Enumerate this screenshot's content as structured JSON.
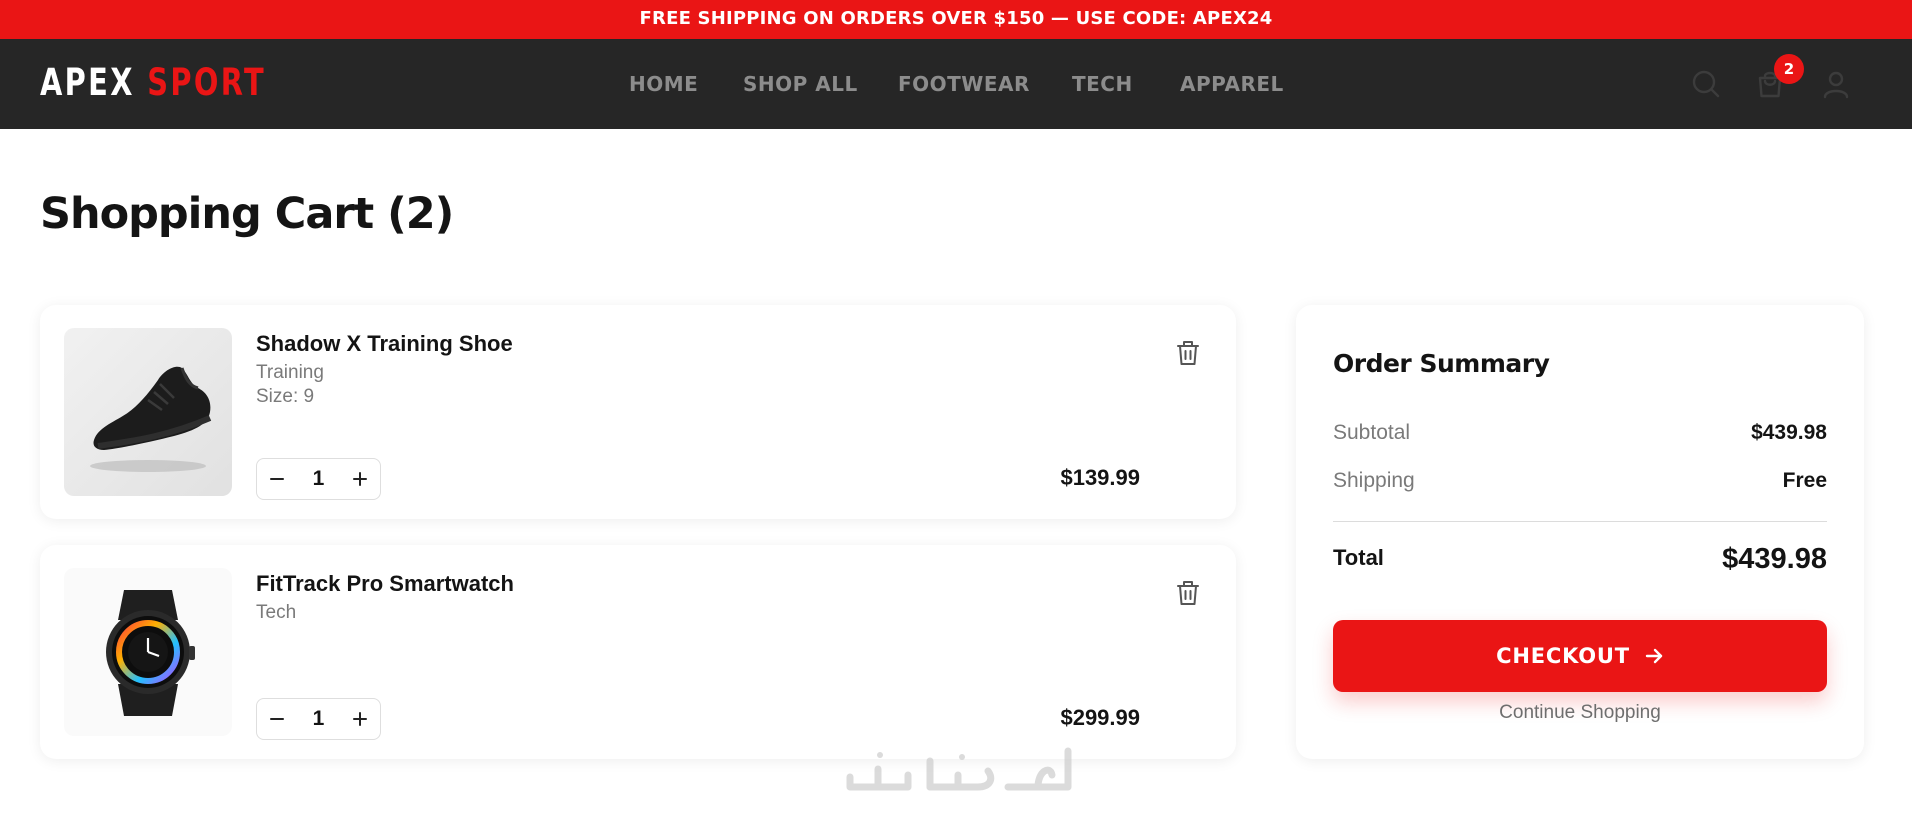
{
  "promo": {
    "text": "FREE SHIPPING ON ORDERS OVER $150 — USE CODE: APEX24"
  },
  "brand": {
    "part1": "APEX",
    "part2": "SPORT"
  },
  "nav": {
    "items": [
      "HOME",
      "SHOP ALL",
      "FOOTWEAR",
      "TECH",
      "APPAREL"
    ]
  },
  "header": {
    "cart_count": "2"
  },
  "page": {
    "title": "Shopping Cart (2)"
  },
  "cart": {
    "items": [
      {
        "name": "Shadow X Training Shoe",
        "category": "Training",
        "size": "Size: 9",
        "quantity": "1",
        "price": "$139.99"
      },
      {
        "name": "FitTrack Pro Smartwatch",
        "category": "Tech",
        "quantity": "1",
        "price": "$299.99"
      }
    ]
  },
  "summary": {
    "title": "Order Summary",
    "subtotal_label": "Subtotal",
    "subtotal_value": "$439.98",
    "shipping_label": "Shipping",
    "shipping_value": "Free",
    "total_label": "Total",
    "total_value": "$439.98",
    "checkout_label": "CHECKOUT",
    "continue_label": "Continue Shopping"
  },
  "colors": {
    "accent": "#ea1515",
    "nav_bg": "#262626",
    "nav_text": "#8c8c8c"
  },
  "icons": {
    "search": "search-icon",
    "bag": "shopping-bag-icon",
    "user": "user-icon",
    "trash": "trash-icon",
    "minus": "minus-icon",
    "plus": "plus-icon",
    "arrow": "arrow-right-icon"
  }
}
